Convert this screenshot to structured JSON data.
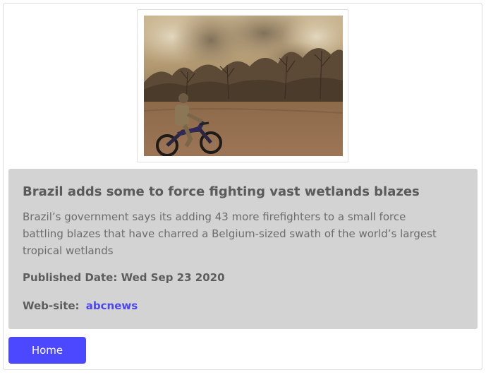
{
  "article": {
    "image_alt": "Firefighter on a motorcycle in front of wetland blaze smoke",
    "title": "Brazil adds some to force fighting vast wetlands blazes",
    "description": "Brazil’s government says its adding 43 more firefighters to a small force battling blazes that have charred a Belgium-sized swath of the world’s largest tropical wetlands",
    "published_label": "Published Date:",
    "published_value": "Wed Sep 23 2020",
    "site_label": "Web-site:",
    "site_value": "abcnews"
  },
  "nav": {
    "home_label": "Home"
  },
  "colors": {
    "panel_bg": "#d3d3d3",
    "link": "#4b48f0",
    "button": "#4b48ff"
  }
}
